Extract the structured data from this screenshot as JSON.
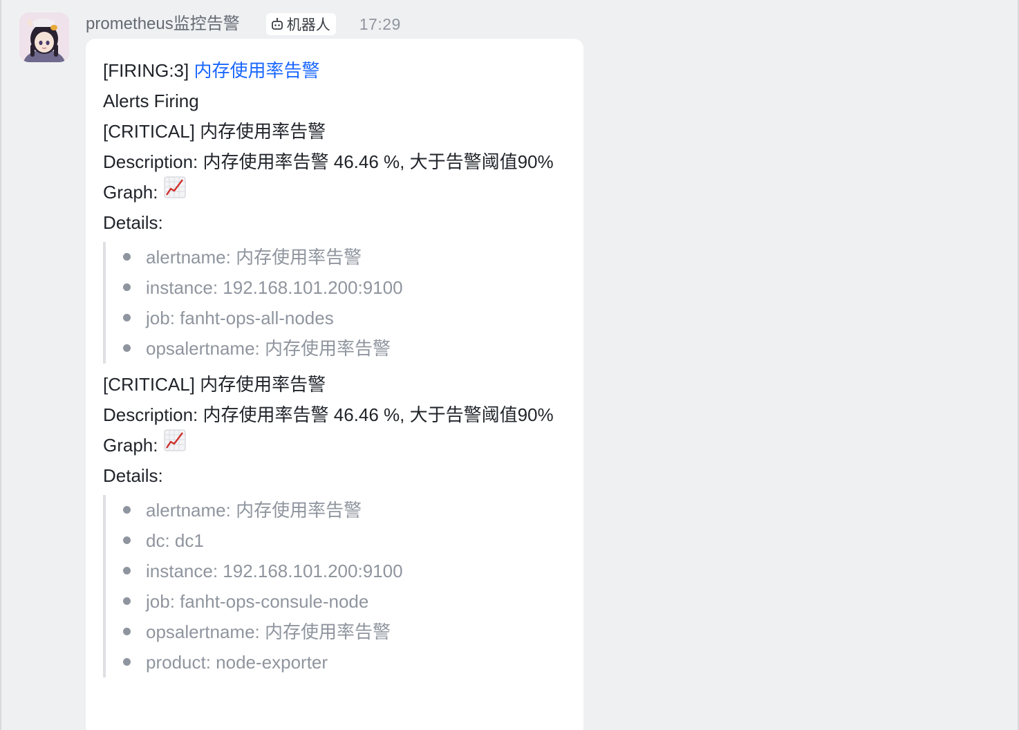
{
  "message": {
    "sender": "prometheus监控告警",
    "badge": "机器人",
    "time": "17:29",
    "header_prefix": "[FIRING:3] ",
    "header_link": "内存使用率告警",
    "alerts_firing": "Alerts Firing",
    "alerts": [
      {
        "title": "[CRITICAL] 内存使用率告警",
        "description_label": "Description:",
        "description_value": " 内存使用率告警 46.46 %, 大于告警阈值90%",
        "graph_label": "Graph:",
        "details_label": "Details:",
        "details": [
          "alertname: 内存使用率告警",
          "instance: 192.168.101.200:9100",
          "job: fanht-ops-all-nodes",
          "opsalertname: 内存使用率告警"
        ]
      },
      {
        "title": "[CRITICAL] 内存使用率告警",
        "description_label": "Description:",
        "description_value": " 内存使用率告警 46.46 %, 大于告警阈值90%",
        "graph_label": "Graph:",
        "details_label": "Details:",
        "details": [
          "alertname: 内存使用率告警",
          "dc: dc1",
          "instance: 192.168.101.200:9100",
          "job: fanht-ops-consule-node",
          "opsalertname: 内存使用率告警",
          "product: node-exporter"
        ]
      }
    ]
  },
  "icons": {
    "avatar": "anime-avatar",
    "badge": "robot-icon",
    "graph": "chart-increasing-icon"
  },
  "colors": {
    "link": "#1966ff",
    "text": "#1f2329",
    "muted": "#8f959e",
    "background": "#eff0f2",
    "bubble": "#ffffff"
  }
}
